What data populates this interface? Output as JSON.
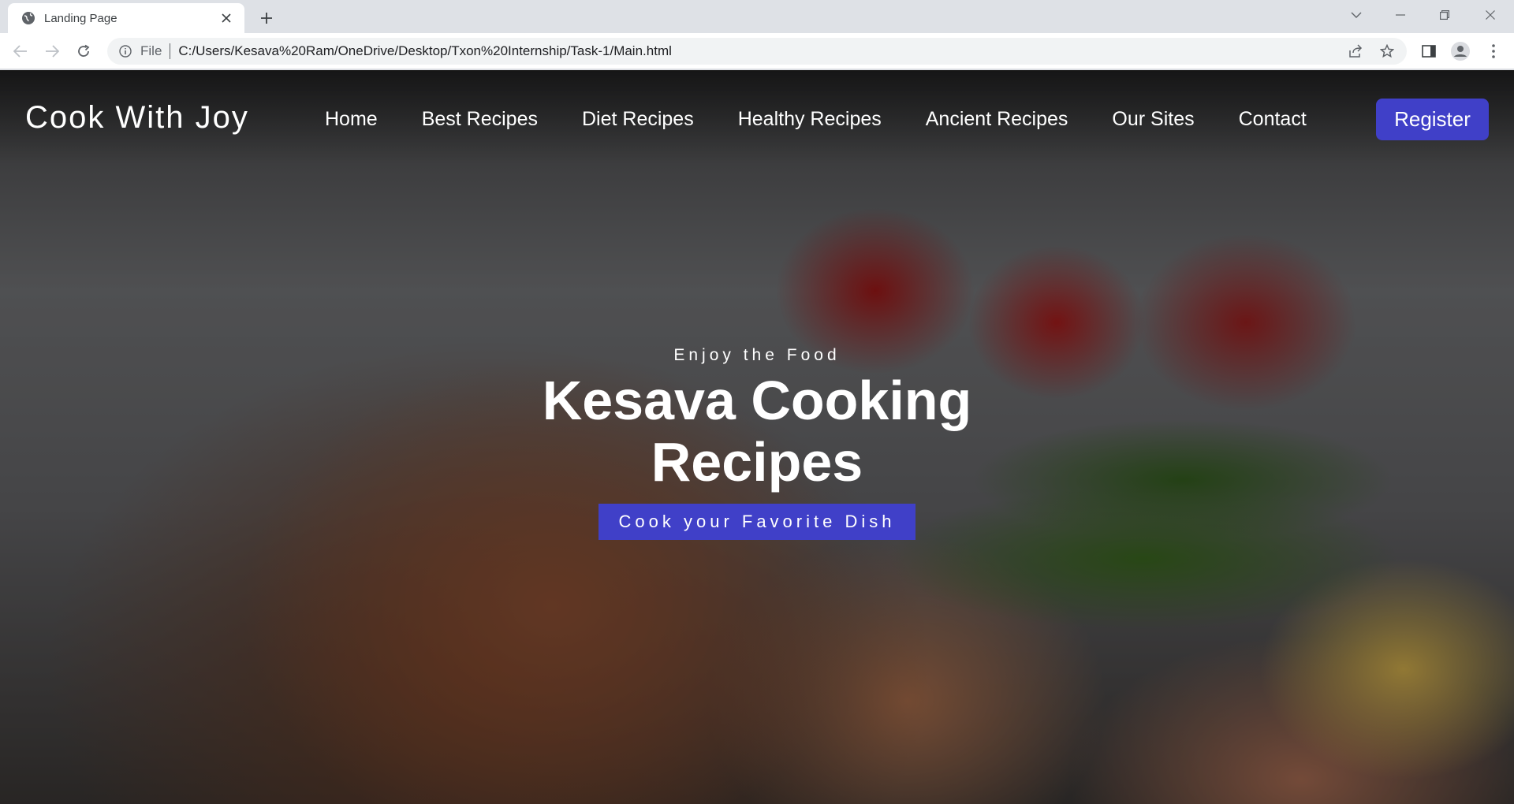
{
  "browser": {
    "tab_title": "Landing Page",
    "address_scheme_label": "File",
    "address_url": "C:/Users/Kesava%20Ram/OneDrive/Desktop/Txon%20Internship/Task-1/Main.html"
  },
  "site": {
    "brand": "Cook With Joy",
    "nav": [
      {
        "label": "Home"
      },
      {
        "label": "Best Recipes"
      },
      {
        "label": "Diet Recipes"
      },
      {
        "label": "Healthy Recipes"
      },
      {
        "label": "Ancient Recipes"
      },
      {
        "label": "Our Sites"
      },
      {
        "label": "Contact"
      }
    ],
    "register_label": "Register",
    "accent_color": "#4040c8"
  },
  "hero": {
    "kicker": "Enjoy the Food",
    "title_line1": "Kesava Cooking",
    "title_line2": "Recipes",
    "cta_label": "Cook your Favorite Dish"
  }
}
